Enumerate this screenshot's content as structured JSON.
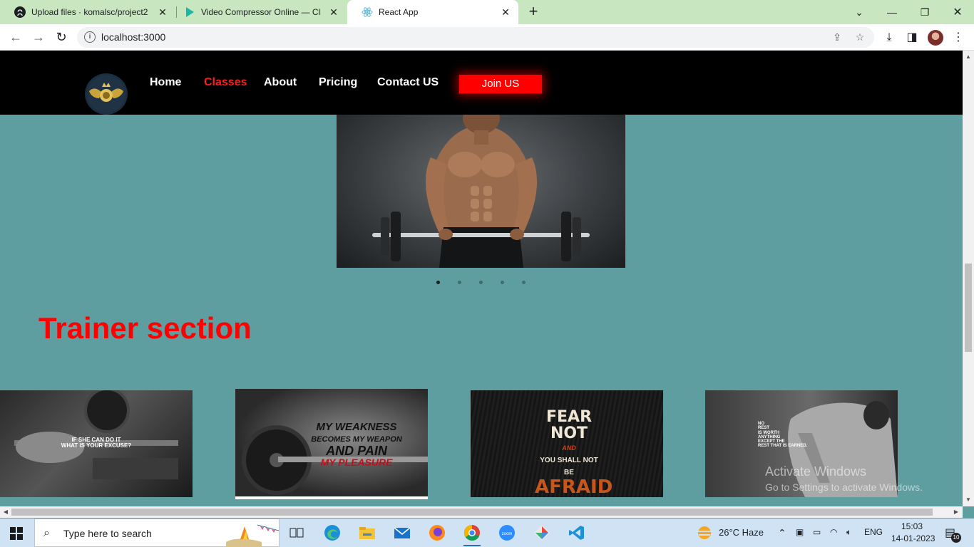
{
  "browser": {
    "tabs": [
      {
        "title": "Upload files · komalsc/project2",
        "icon": "github-icon"
      },
      {
        "title": "Video Compressor Online — Clic",
        "icon": "clideo-play-icon"
      },
      {
        "title": "React App",
        "icon": "react-icon",
        "active": true
      }
    ],
    "url": "localhost:3000"
  },
  "nav": {
    "links": [
      "Home",
      "Classes",
      "About",
      "Pricing",
      "Contact US"
    ],
    "active": "Classes",
    "join_label": "Join US"
  },
  "carousel": {
    "slide_count": 5,
    "active_index": 0
  },
  "trainer": {
    "title": "Trainer section",
    "cards": [
      {
        "line1": "IF SHE CAN DO IT",
        "line2": "WHAT IS YOUR EXCUSE?"
      },
      {
        "line1": "MY WEAKNESS",
        "line2": "BECOMES MY WEAPON",
        "line3": "AND PAIN",
        "line4": "MY PLEASURE"
      },
      {
        "line1": "FEAR NOT",
        "line2": "AND",
        "line3": "YOU SHALL NOT BE",
        "line4": "AFRAID"
      },
      {
        "line1": "NO",
        "line2": "REST",
        "line3": "IS WORTH",
        "line4": "ANYTHING",
        "line5": "EXCEPT THE",
        "line6": "REST THAT IS EARNED."
      }
    ]
  },
  "watermark": {
    "title": "Activate Windows",
    "subtitle": "Go to Settings to activate Windows."
  },
  "taskbar": {
    "search_placeholder": "Type here to search",
    "weather": "26°C  Haze",
    "language": "ENG",
    "time": "15:03",
    "date": "14-01-2023",
    "notification_count": "10"
  }
}
